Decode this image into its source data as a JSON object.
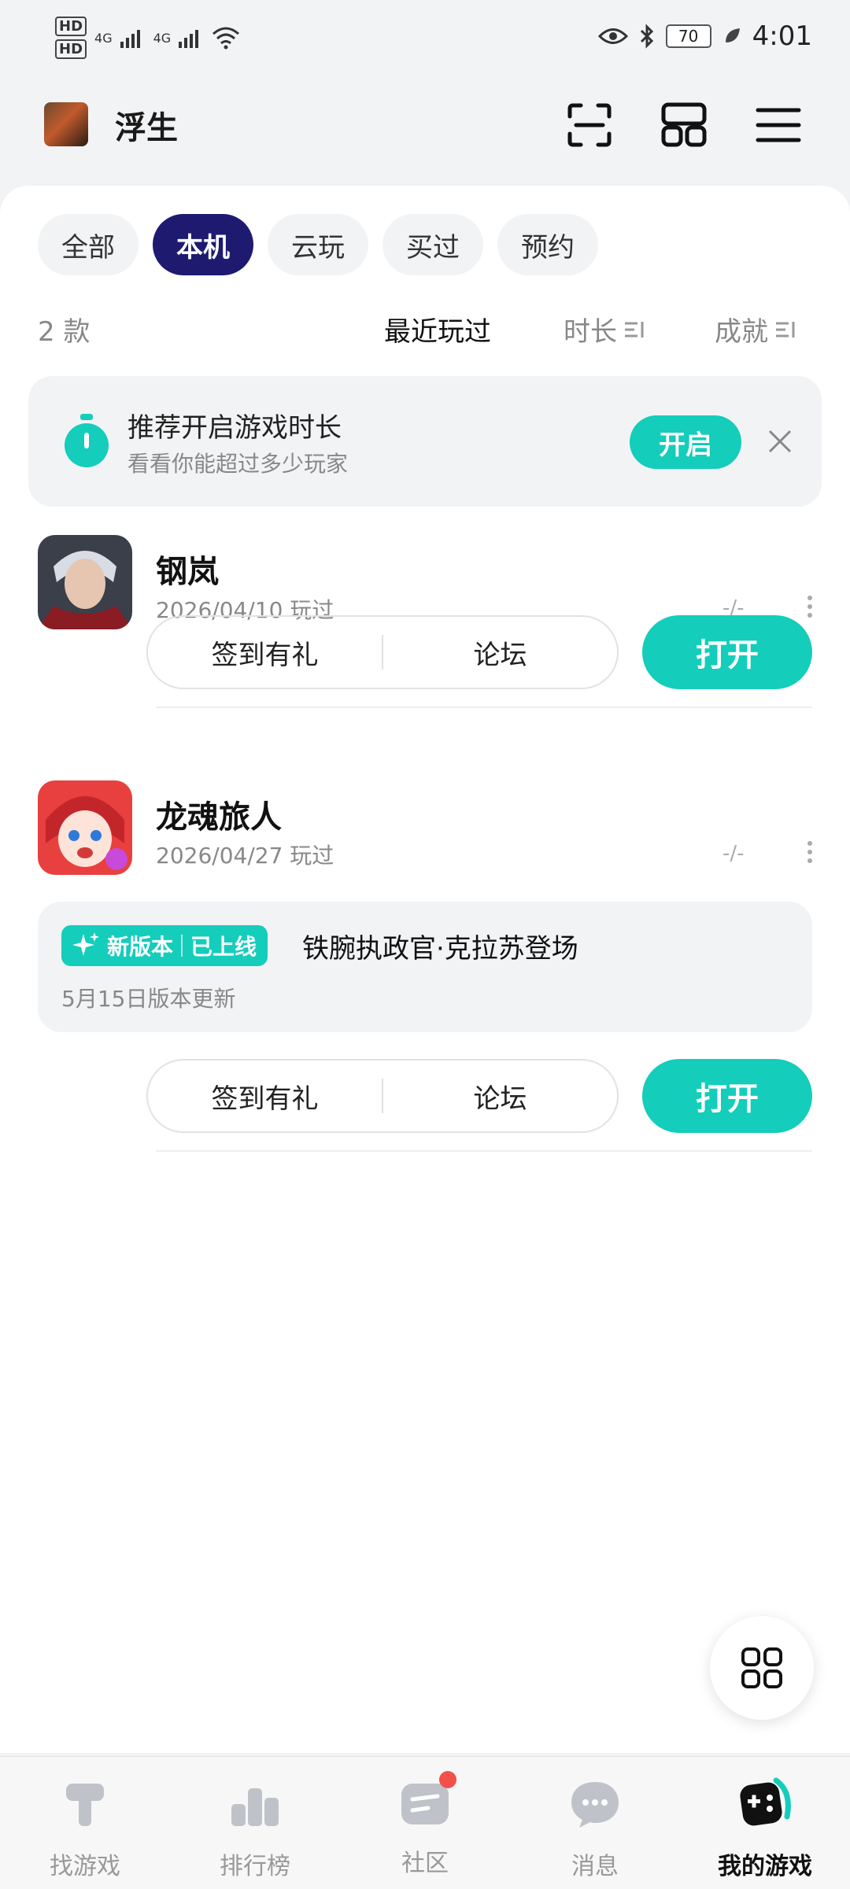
{
  "status_bar": {
    "hd1": "HD",
    "hd2": "HD",
    "net1": "4G",
    "net2": "4G",
    "battery": "70",
    "time": "4:01"
  },
  "header": {
    "username": "浮生"
  },
  "tabs": [
    "全部",
    "本机",
    "云玩",
    "买过",
    "预约"
  ],
  "active_tab": "本机",
  "list_bar": {
    "count": "2 款",
    "sort_recent": "最近玩过",
    "sort_duration": "时长",
    "sort_achievement": "成就"
  },
  "tip": {
    "title": "推荐开启游戏时长",
    "subtitle": "看看你能超过多少玩家",
    "button": "开启"
  },
  "games": [
    {
      "name": "钢岚",
      "date": "2026/04/10 玩过",
      "stat": "-/-",
      "checkin": "签到有礼",
      "forum": "论坛",
      "open": "打开"
    },
    {
      "name": "龙魂旅人",
      "date": "2026/04/27 玩过",
      "stat": "-/-",
      "checkin": "签到有礼",
      "forum": "论坛",
      "open": "打开",
      "update": {
        "badge_new": "新版本",
        "badge_online": "已上线",
        "title": "铁腕执政官·克拉苏登场",
        "subtitle": "5月15日版本更新"
      }
    }
  ],
  "nav": {
    "items": [
      "找游戏",
      "排行榜",
      "社区",
      "消息",
      "我的游戏"
    ],
    "active": "我的游戏"
  },
  "colors": {
    "accent": "#14cdbb",
    "active_chip": "#1d1a70",
    "notification": "#f2504b"
  }
}
